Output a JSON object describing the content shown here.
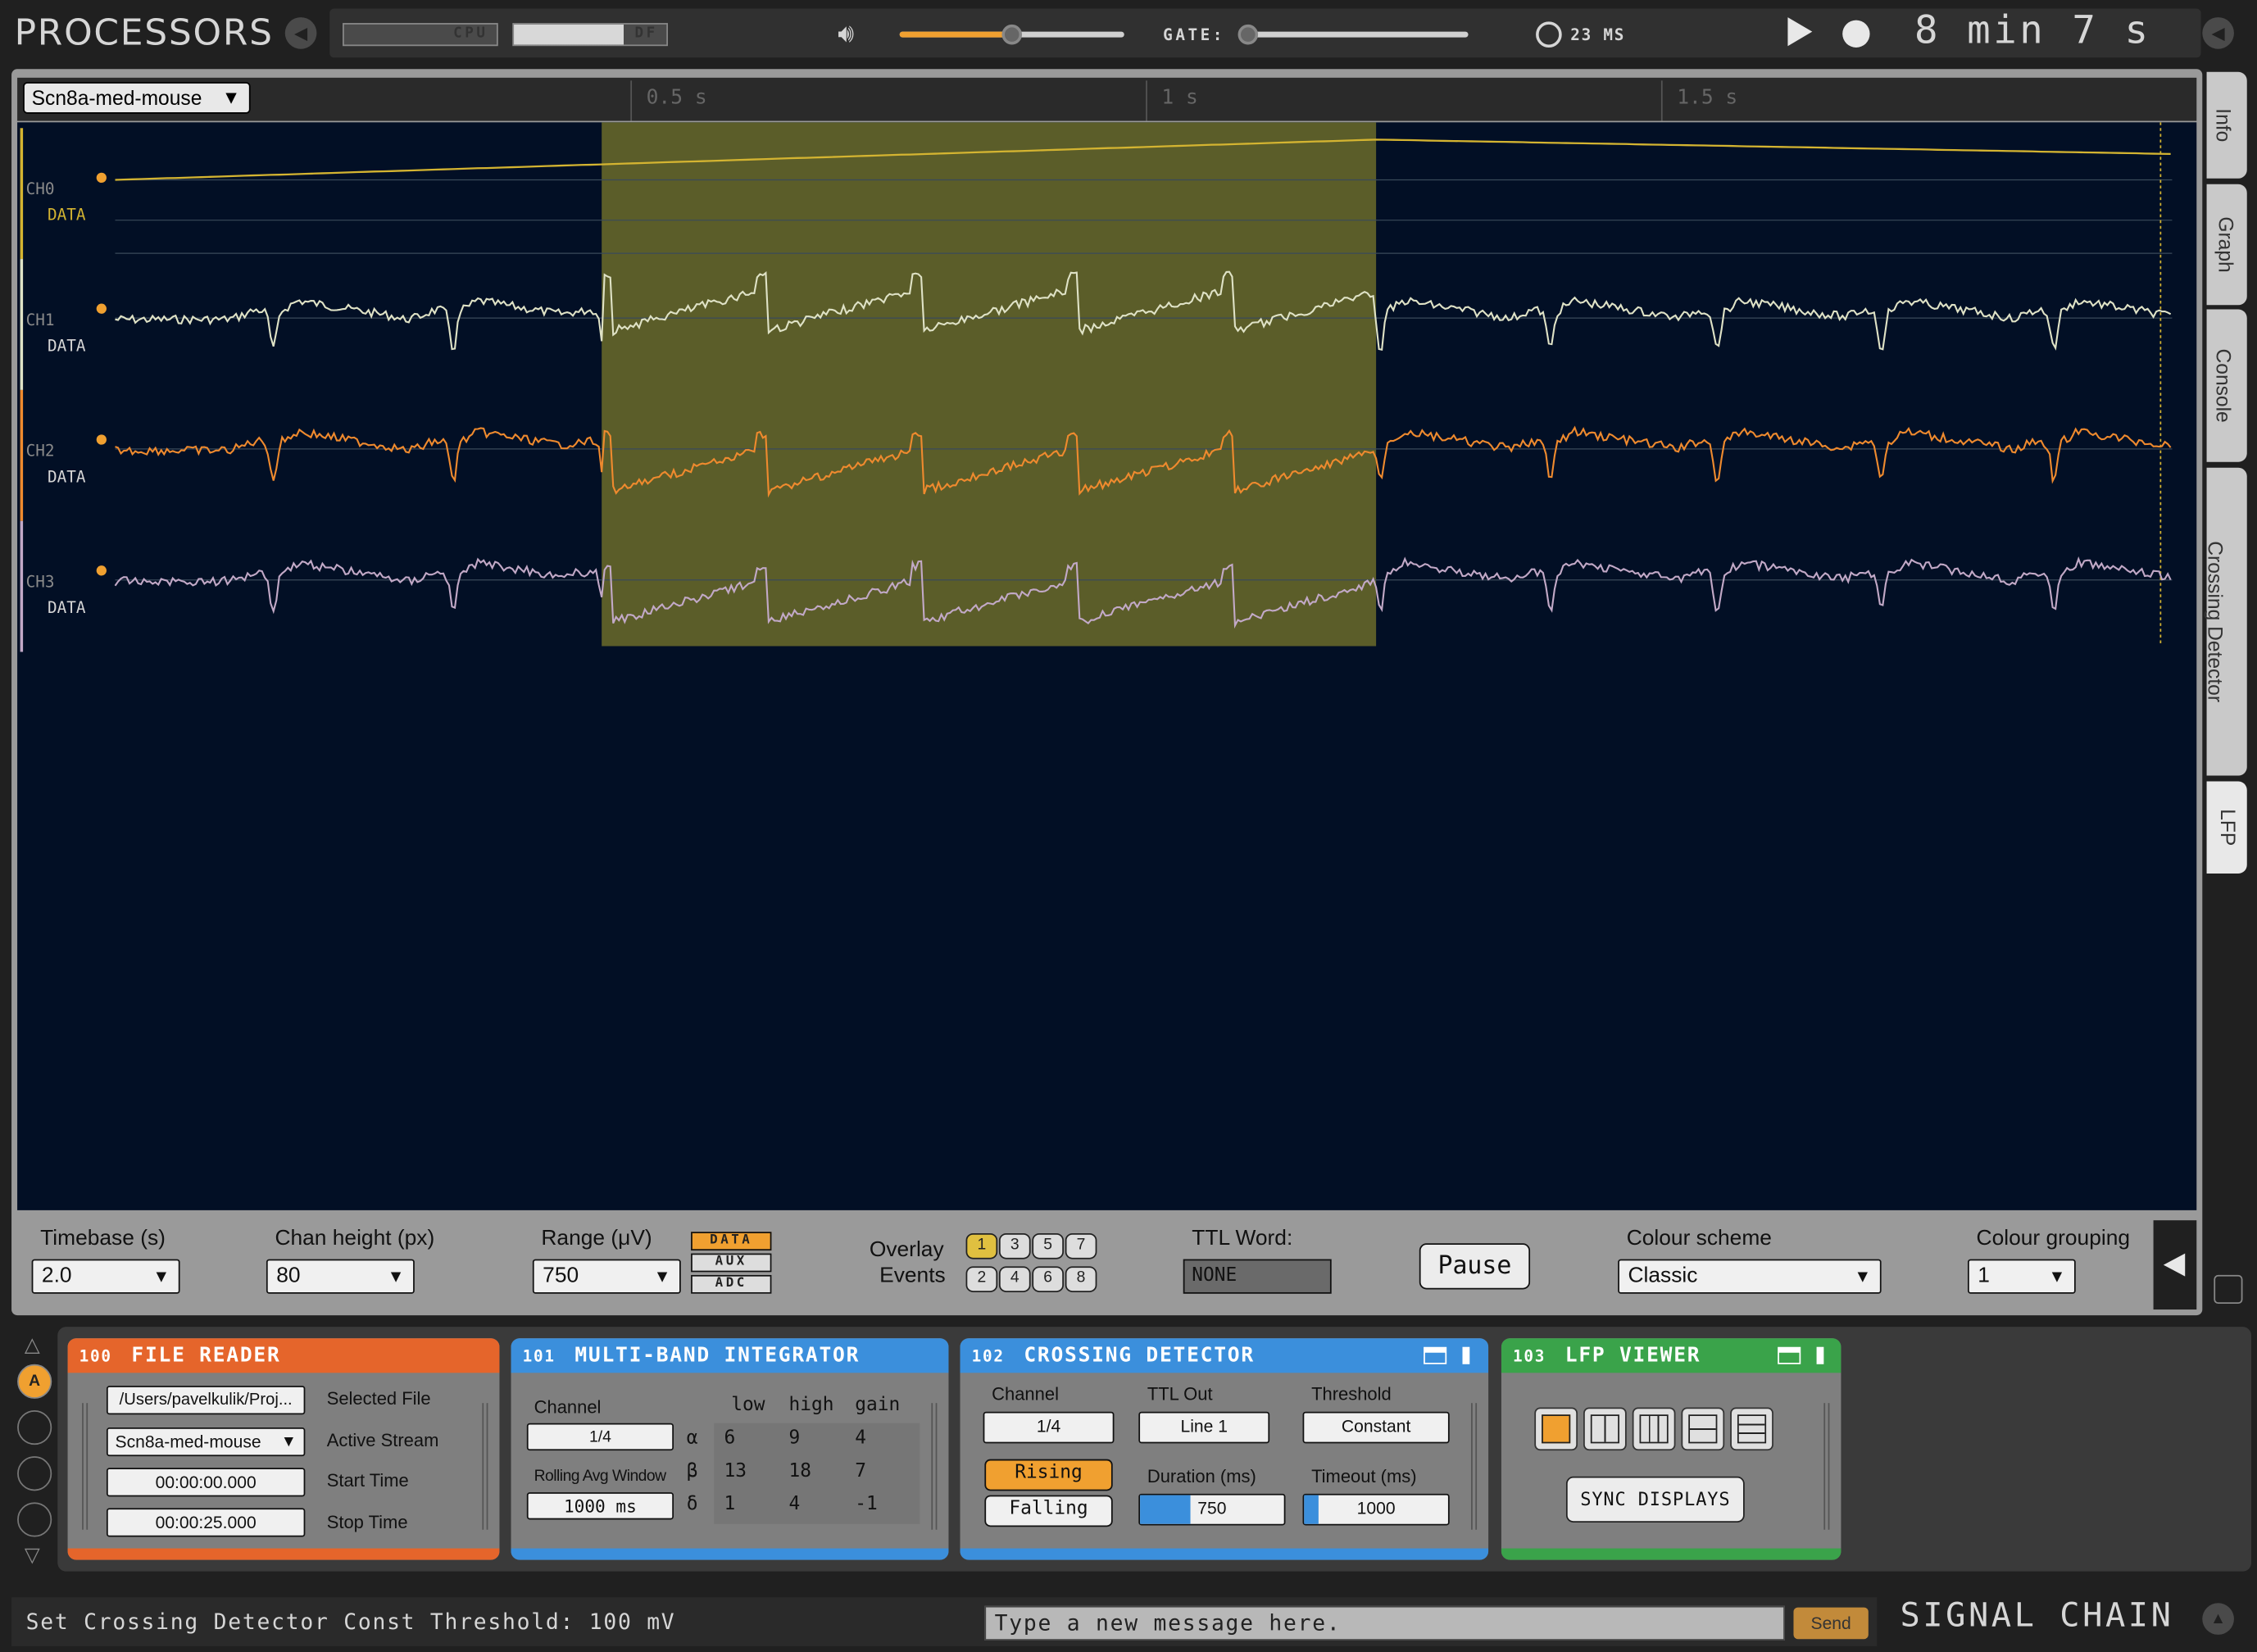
{
  "header": {
    "title": "PROCESSORS",
    "cpu_label": "CPU",
    "df_label": "DF",
    "gate_label": "GATE:",
    "latency": "23 MS",
    "clock": "8 min 7 s",
    "volume_level": 0.5,
    "gate_level": 0.0
  },
  "tabs_right": [
    "Info",
    "Graph",
    "Console",
    "Crossing Detector",
    "LFP"
  ],
  "viewer": {
    "stream": "Scn8a-med-mouse",
    "ticks": [
      "0.5 s",
      "1 s",
      "1.5 s"
    ],
    "channels": [
      {
        "name": "CH0",
        "type": "DATA",
        "color": "#d4b431"
      },
      {
        "name": "CH1",
        "type": "DATA",
        "color": "#dfe2c6"
      },
      {
        "name": "CH2",
        "type": "DATA",
        "color": "#ef8a2e"
      },
      {
        "name": "CH3",
        "type": "DATA",
        "color": "#c2a9c7"
      }
    ]
  },
  "options": {
    "timebase_label": "Timebase (s)",
    "timebase_value": "2.0",
    "chan_height_label": "Chan height (px)",
    "chan_height_value": "80",
    "range_label": "Range (μV)",
    "range_value": "750",
    "range_types": [
      "DATA",
      "AUX",
      "ADC"
    ],
    "overlay_label1": "Overlay",
    "overlay_label2": "Events",
    "overlay_events": [
      "1",
      "3",
      "5",
      "7",
      "2",
      "4",
      "6",
      "8"
    ],
    "ttl_label": "TTL Word:",
    "ttl_value": "NONE",
    "pause_label": "Pause",
    "colour_scheme_label": "Colour scheme",
    "colour_scheme_value": "Classic",
    "colour_grouping_label": "Colour grouping",
    "colour_grouping_value": "1"
  },
  "chain": {
    "slot_labels": [
      "A"
    ],
    "processors": [
      {
        "id": "100",
        "name": "FILE READER",
        "color": "#e5652b",
        "file": "/Users/pavelkulik/Proj...",
        "file_label": "Selected File",
        "stream": "Scn8a-med-mouse",
        "stream_label": "Active Stream",
        "start": "00:00:00.000",
        "start_label": "Start Time",
        "stop": "00:00:25.000",
        "stop_label": "Stop Time"
      },
      {
        "id": "101",
        "name": "MULTI-BAND INTEGRATOR",
        "color": "#3b8fdc",
        "channel_label": "Channel",
        "channel": "1/4",
        "rolling_label": "Rolling Avg Window",
        "rolling": "1000 ms",
        "cols": [
          "low",
          "high",
          "gain"
        ],
        "rows": [
          {
            "band": "α",
            "low": "6",
            "high": "9",
            "gain": "4"
          },
          {
            "band": "β",
            "low": "13",
            "high": "18",
            "gain": "7"
          },
          {
            "band": "δ",
            "low": "1",
            "high": "4",
            "gain": "-1"
          }
        ]
      },
      {
        "id": "102",
        "name": "CROSSING DETECTOR",
        "color": "#3b8fdc",
        "channel_label": "Channel",
        "channel": "1/4",
        "ttl_label": "TTL Out",
        "ttl": "Line 1",
        "threshold_label": "Threshold",
        "threshold": "Constant",
        "rising": "Rising",
        "falling": "Falling",
        "duration_label": "Duration (ms)",
        "duration": "750",
        "timeout_label": "Timeout (ms)",
        "timeout": "1000"
      },
      {
        "id": "103",
        "name": "LFP VIEWER",
        "color": "#3aa34a",
        "sync_label": "SYNC DISPLAYS"
      }
    ]
  },
  "footer": {
    "message": "Set Crossing Detector Const Threshold: 100 mV",
    "input_placeholder": "Type a new message here.",
    "send_label": "Send",
    "chain_title": "SIGNAL CHAIN"
  }
}
